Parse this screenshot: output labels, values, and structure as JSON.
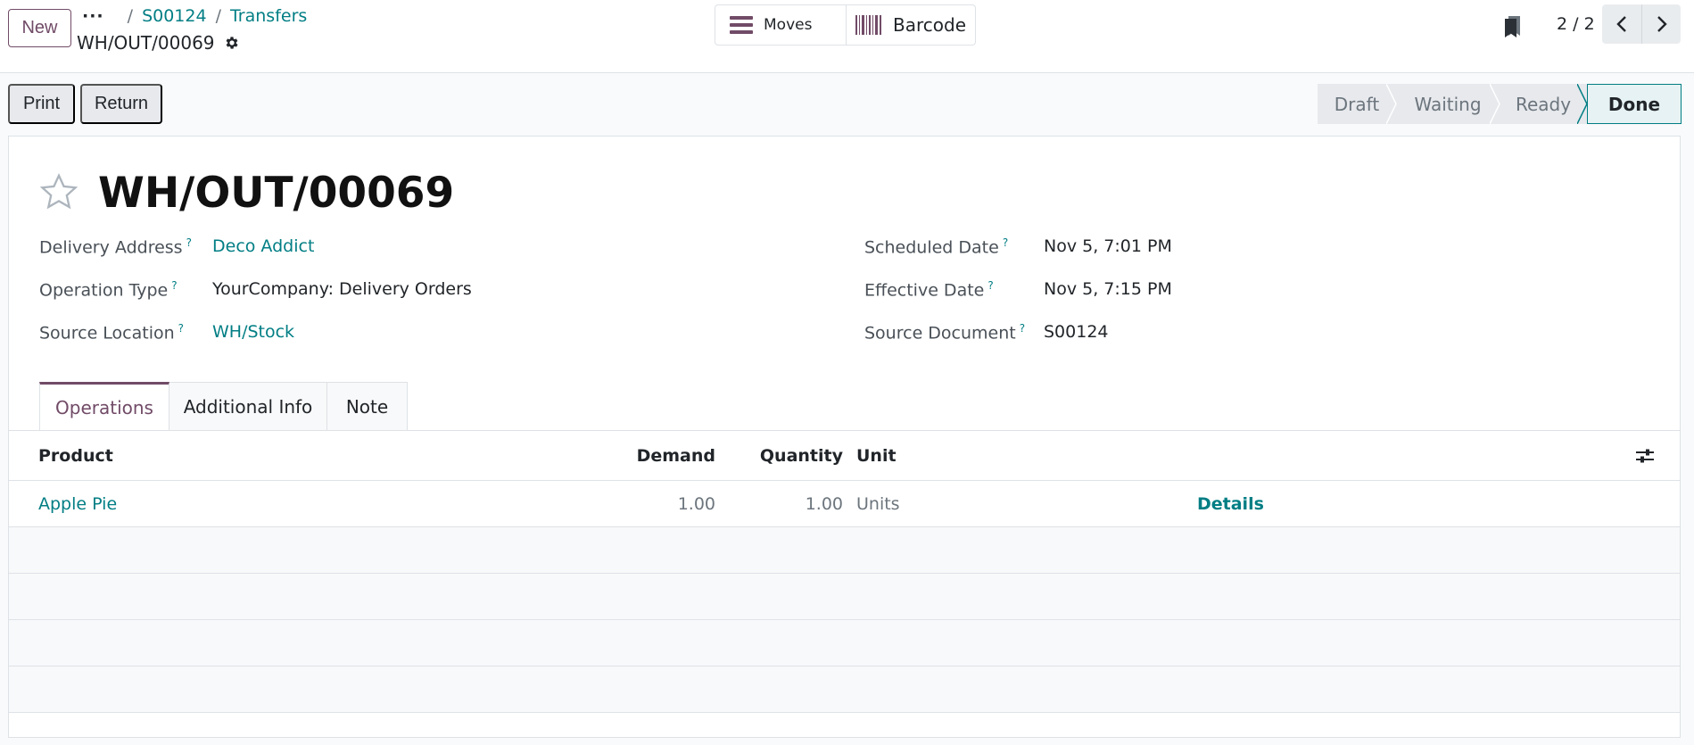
{
  "topbar": {
    "new_label": "New",
    "breadcrumb": {
      "dots": "···",
      "items": [
        "S00124",
        "Transfers"
      ]
    },
    "record_name": "WH/OUT/00069",
    "smart_buttons": {
      "moves": "Moves",
      "barcode": "Barcode"
    },
    "pager": {
      "value": "2 / 2"
    }
  },
  "actions": {
    "print": "Print",
    "return": "Return"
  },
  "status": {
    "stages": [
      "Draft",
      "Waiting",
      "Ready",
      "Done"
    ],
    "current": "Done"
  },
  "form": {
    "title": "WH/OUT/00069",
    "tooltip_mark": "?",
    "left_fields": [
      {
        "label": "Delivery Address",
        "value": "Deco Addict"
      },
      {
        "label": "Operation Type",
        "value": "YourCompany: Delivery Orders"
      },
      {
        "label": "Source Location",
        "value": "WH/Stock"
      }
    ],
    "right_fields": [
      {
        "label": "Scheduled Date",
        "value": "Nov 5, 7:01 PM"
      },
      {
        "label": "Effective Date",
        "value": "Nov 5, 7:15 PM"
      },
      {
        "label": "Source Document",
        "value": "S00124"
      }
    ]
  },
  "tabs": [
    "Operations",
    "Additional Info",
    "Note"
  ],
  "operations": {
    "columns": {
      "product": "Product",
      "demand": "Demand",
      "quantity": "Quantity",
      "unit": "Unit"
    },
    "rows": [
      {
        "product": "Apple Pie",
        "demand": "1.00",
        "quantity": "1.00",
        "unit": "Units",
        "action": "Details"
      }
    ]
  },
  "colors": {
    "brand": "#714b67",
    "link": "#017e84",
    "border": "#dee2e6"
  }
}
